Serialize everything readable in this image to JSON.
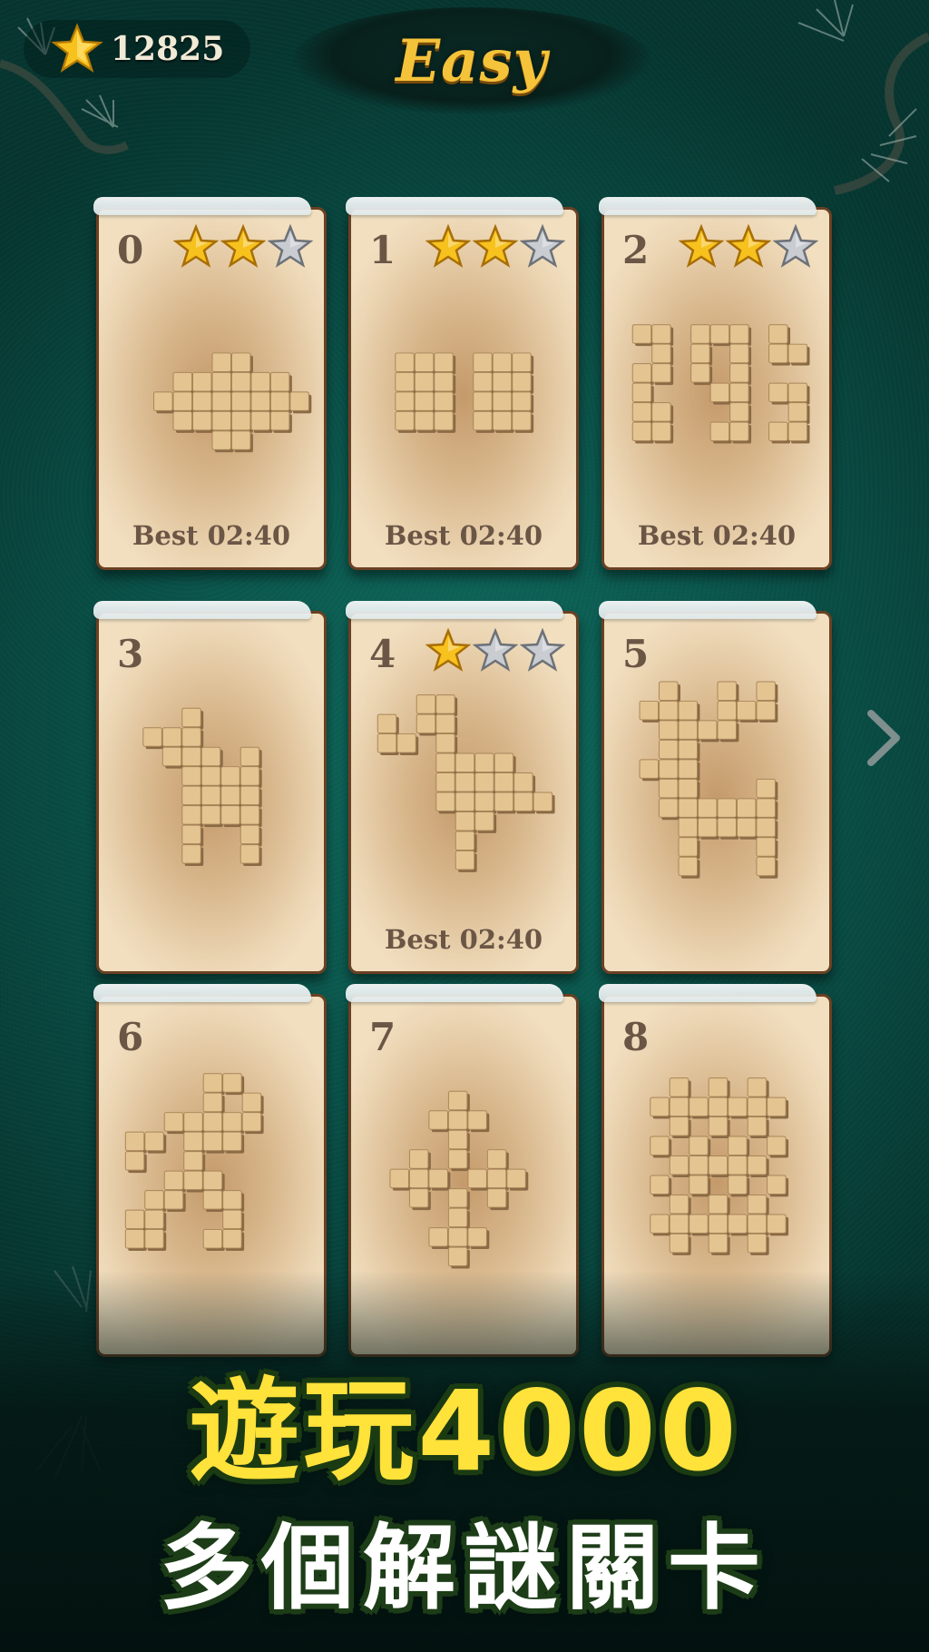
{
  "header": {
    "score": "12825",
    "difficulty": "Easy",
    "score_icon": "gold-star-icon"
  },
  "colors": {
    "felt": "#0b5a50",
    "card_border": "#6b4022",
    "gold_star": "#f7c21e",
    "silver_star": "#c9ccd1",
    "title_gold": "#f5c33a",
    "promo_yellow": "#ffe23a"
  },
  "levels": [
    {
      "number": "0",
      "stars": 2,
      "max_stars": 3,
      "best": "Best 02:40"
    },
    {
      "number": "1",
      "stars": 2,
      "max_stars": 3,
      "best": "Best 02:40"
    },
    {
      "number": "2",
      "stars": 2,
      "max_stars": 3,
      "best": "Best 02:40"
    },
    {
      "number": "3",
      "stars": null,
      "max_stars": 3,
      "best": ""
    },
    {
      "number": "4",
      "stars": 1,
      "max_stars": 3,
      "best": "Best 02:40"
    },
    {
      "number": "5",
      "stars": null,
      "max_stars": 3,
      "best": ""
    },
    {
      "number": "6",
      "stars": null,
      "max_stars": 3,
      "best": ""
    },
    {
      "number": "7",
      "stars": null,
      "max_stars": 3,
      "best": ""
    },
    {
      "number": "8",
      "stars": null,
      "max_stars": 3,
      "best": ""
    }
  ],
  "navigation": {
    "next_icon": "chevron-right-icon"
  },
  "promo": {
    "line1": "遊玩4000",
    "line2": "多個解謎關卡"
  }
}
